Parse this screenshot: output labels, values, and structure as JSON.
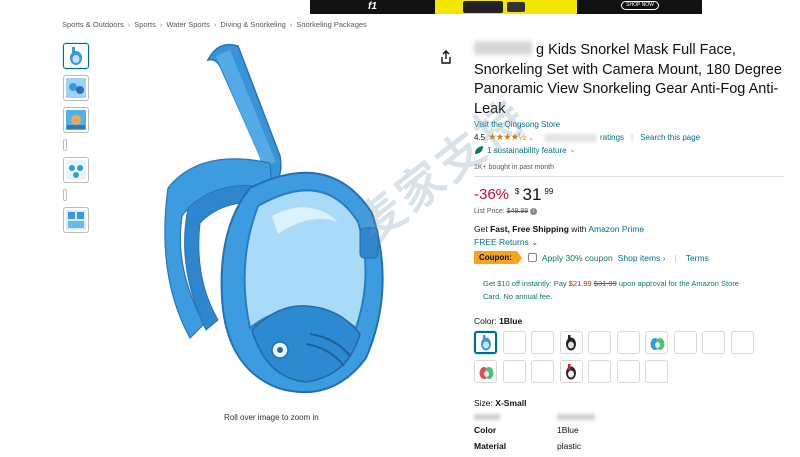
{
  "banner": {
    "brand_mark": "f1",
    "cta": "SHOP NOW"
  },
  "breadcrumb": [
    "Sports & Outdoors",
    "Sports",
    "Water Sports",
    "Diving & Snorkeling",
    "Snorkeling Packages"
  ],
  "breadcrumb_sep": "›",
  "image": {
    "zoom_hint": "Roll over image to zoom in"
  },
  "product": {
    "title_rest": "g Kids Snorkel Mask Full Face, Snorkeling Set with Camera Mount, 180 Degree Panoramic View Snorkeling Gear Anti-Fog Anti-Leak",
    "store_link": "Visit the Qingsong Store",
    "rating_value": "4.5",
    "stars": "★★★★½",
    "rating_caret": "⌄",
    "ratings_suffix": "ratings",
    "search_page": "Search this page",
    "sustainability": "1 sustainability feature",
    "sustain_caret": "⌄",
    "bought": "1K+ bought in past month"
  },
  "price": {
    "discount": "-36%",
    "symbol": "$",
    "whole": "31",
    "fraction": "99",
    "list_label": "List Price:",
    "list_value": "$49.99"
  },
  "shipping": {
    "prefix": "Get ",
    "bold": "Fast, Free Shipping",
    "middle": " with ",
    "prime": "Amazon Prime"
  },
  "returns": "FREE Returns ⌄",
  "coupon": {
    "badge": "Coupon:",
    "apply": "Apply 30% coupon",
    "shop_items": "Shop items ›",
    "terms": "Terms"
  },
  "promo": {
    "line1_prefix": "Get $10 off instantly: Pay ",
    "pay": "$21.99",
    "strike": "$31.99",
    "line1_suffix": " upon approval for the Amazon Store",
    "line2": "Card. No annual fee."
  },
  "color": {
    "label": "Color:",
    "value": "1Blue"
  },
  "size": {
    "label": "Size:",
    "value": "X-Small"
  },
  "attributes": [
    {
      "key": "Color",
      "value": "1Blue"
    },
    {
      "key": "Material",
      "value": "plastic"
    }
  ],
  "watermark": "麦家支持",
  "colors": {
    "link": "#007185",
    "discount": "#cc0c39",
    "star": "#de7921",
    "coupon": "#f7a41d",
    "mask_blue": "#3a9ad9"
  }
}
